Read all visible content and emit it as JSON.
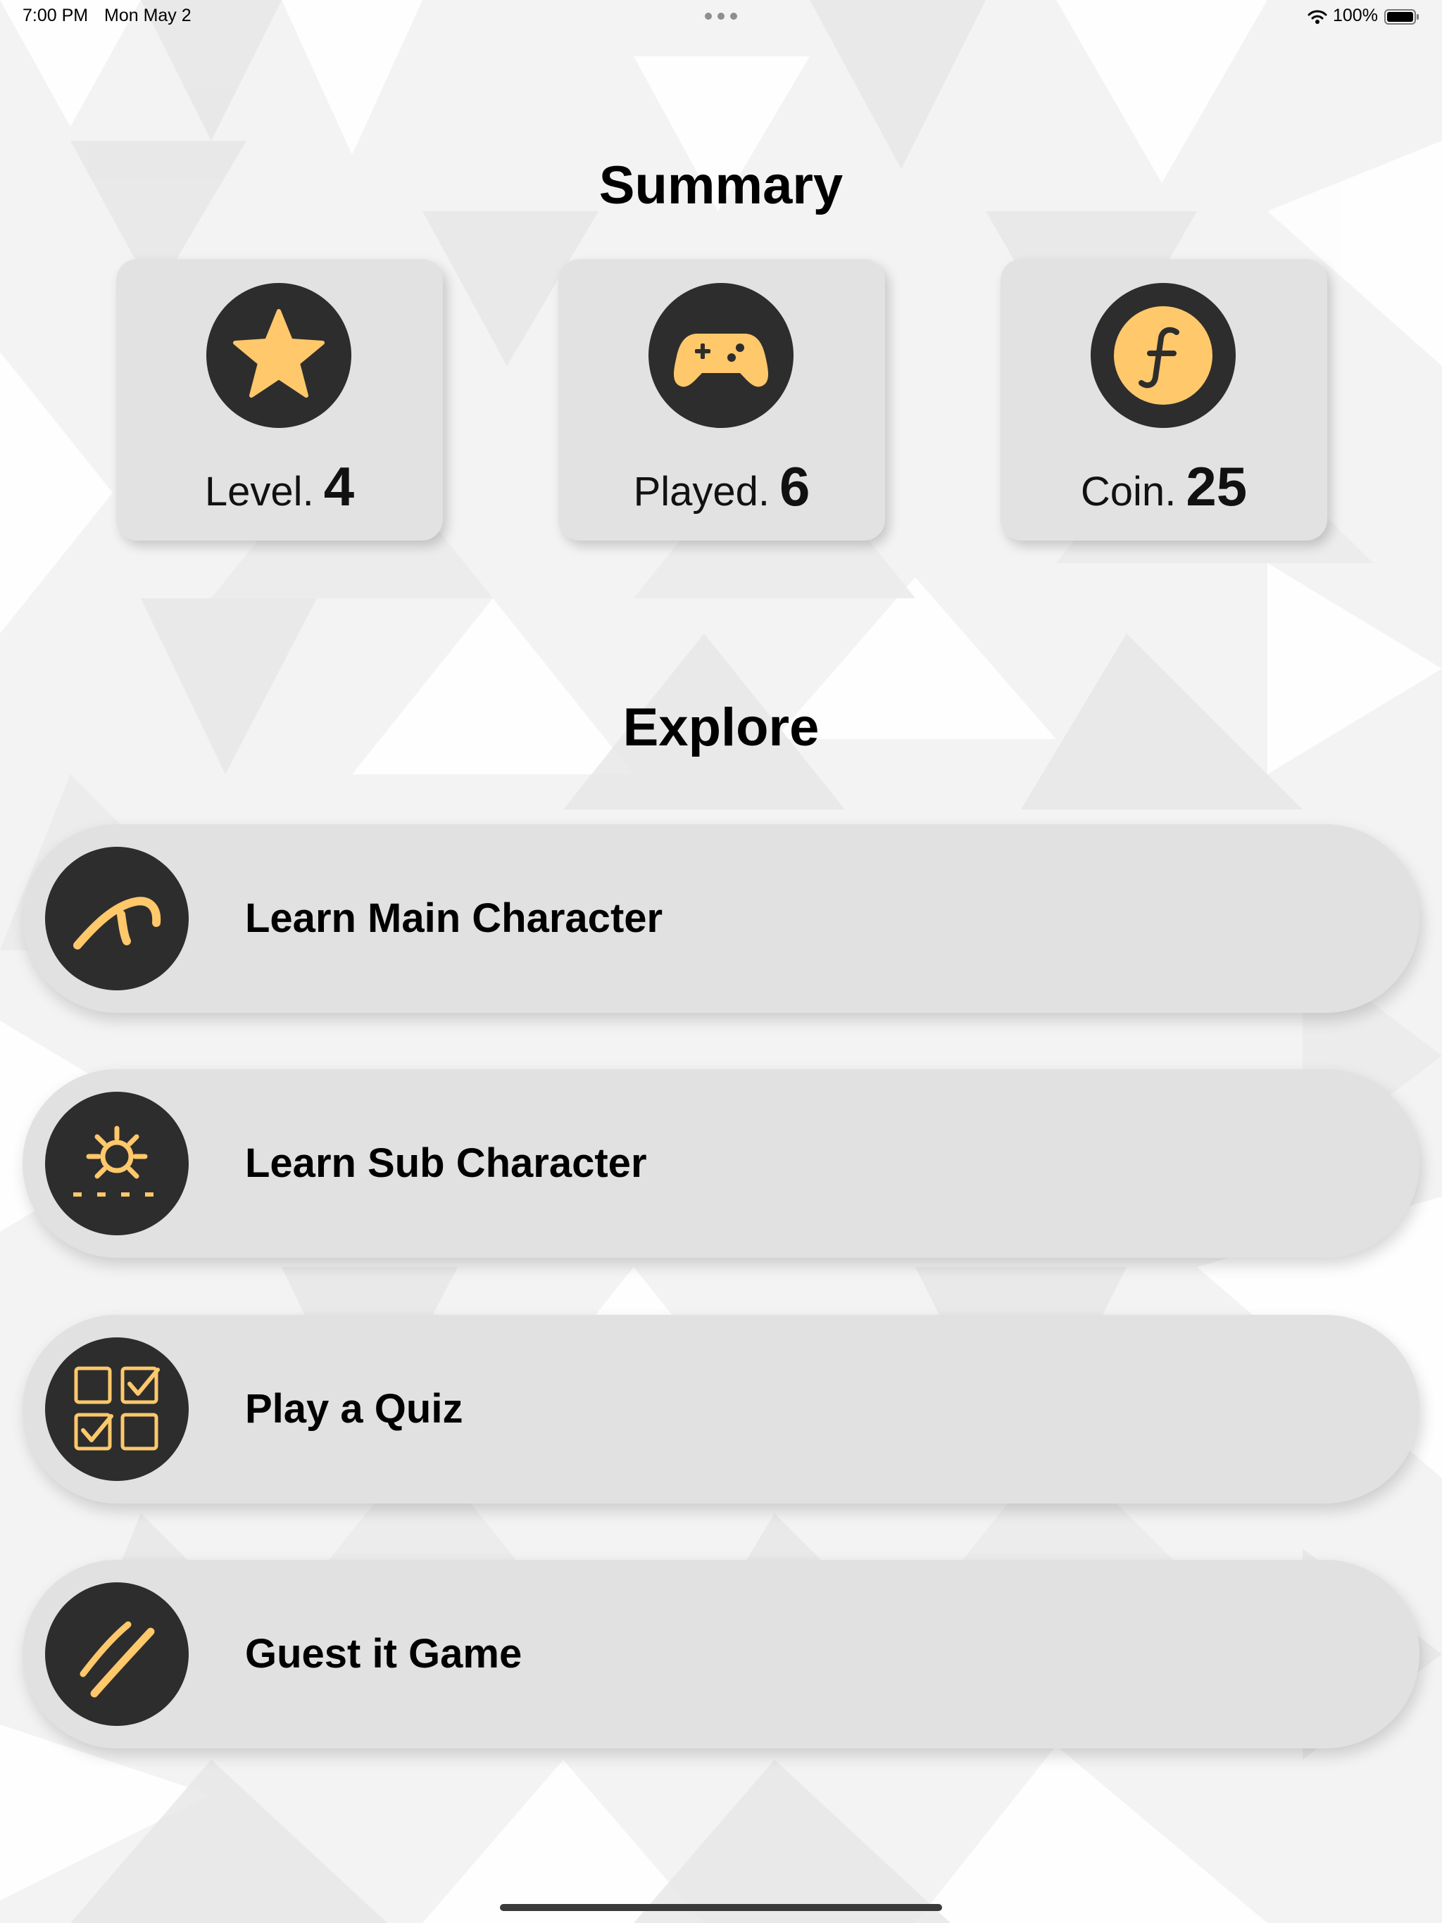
{
  "status_bar": {
    "time": "7:00 PM",
    "date": "Mon May 2",
    "battery_percent": "100%",
    "icons": [
      "multitasking-dots-icon",
      "wifi-icon",
      "battery-icon"
    ]
  },
  "summary": {
    "title": "Summary",
    "cards": [
      {
        "label": "Level.",
        "value": "4",
        "icon": "star-icon"
      },
      {
        "label": "Played.",
        "value": "6",
        "icon": "gamepad-icon"
      },
      {
        "label": "Coin.",
        "value": "25",
        "icon": "coin-icon"
      }
    ]
  },
  "explore": {
    "title": "Explore",
    "items": [
      {
        "label": "Learn Main Character",
        "icon": "main-character-glyph-icon"
      },
      {
        "label": "Learn Sub Character",
        "icon": "sub-character-glyph-icon"
      },
      {
        "label": "Play a Quiz",
        "icon": "quiz-checkbox-icon"
      },
      {
        "label": "Guest it Game",
        "icon": "guess-slash-icon"
      }
    ]
  },
  "colors": {
    "accent": "#fec86b",
    "icon_background": "#2d2d2d",
    "card_background": "#e2e2e2",
    "page_background": "#f4f4f4"
  }
}
